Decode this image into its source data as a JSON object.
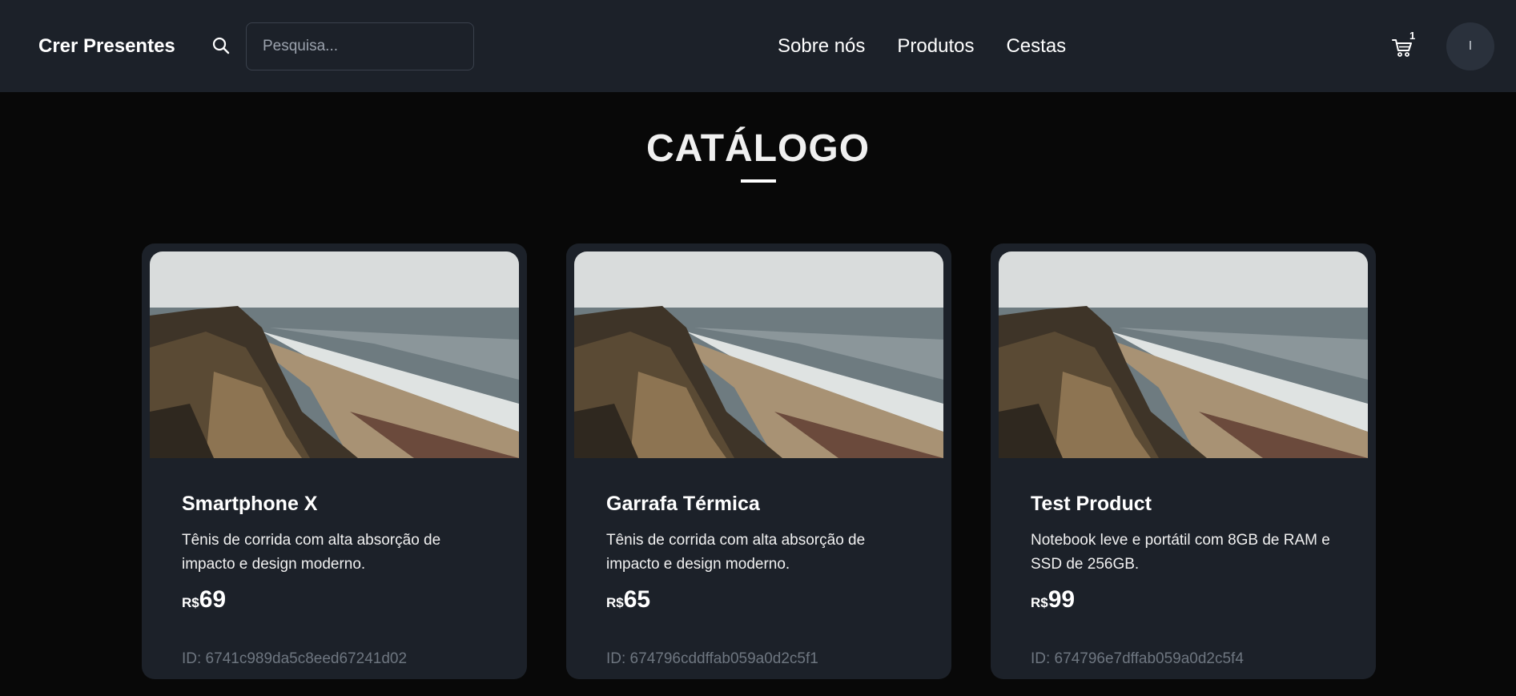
{
  "header": {
    "brand": "Crer Presentes",
    "search_placeholder": "Pesquisa...",
    "nav": [
      "Sobre nós",
      "Produtos",
      "Cestas"
    ],
    "cart_count": "1",
    "avatar_initial": "I"
  },
  "main": {
    "title": "CATÁLOGO"
  },
  "products": [
    {
      "name": "Smartphone X",
      "description": "Tênis de corrida com alta absorção de impacto e design moderno.",
      "currency": "R$",
      "price": "69",
      "id": "ID: 6741c989da5c8eed67241d02"
    },
    {
      "name": "Garrafa Térmica",
      "description": "Tênis de corrida com alta absorção de impacto e design moderno.",
      "currency": "R$",
      "price": "65",
      "id": "ID: 674796cddffab059a0d2c5f1"
    },
    {
      "name": "Test Product",
      "description": "Notebook leve e portátil com 8GB de RAM e SSD de 256GB.",
      "currency": "R$",
      "price": "99",
      "id": "ID: 674796e7dffab059a0d2c5f4"
    }
  ],
  "colors": {
    "page_bg": "#080808",
    "surface": "#1c2129",
    "muted_text": "#6e7680"
  },
  "icons": {
    "search": "search-icon",
    "cart": "cart-icon"
  }
}
